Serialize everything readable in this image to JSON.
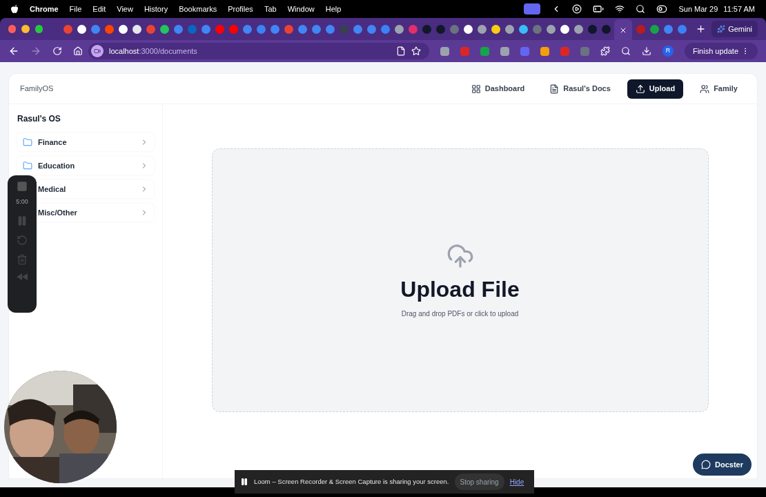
{
  "menubar": {
    "app": "Chrome",
    "menus": [
      "File",
      "Edit",
      "View",
      "History",
      "Bookmarks",
      "Profiles",
      "Tab",
      "Window",
      "Help"
    ],
    "date": "Sun Mar 29",
    "time": "11:57 AM"
  },
  "browser": {
    "url_host": "localhost",
    "url_path": ":3000/documents",
    "profile": "R",
    "update_button": "Finish update",
    "gemini": "Gemini"
  },
  "app": {
    "brand": "FamilyOS",
    "nav": [
      {
        "label": "Dashboard",
        "kind": "grid",
        "selected": false
      },
      {
        "label": "Rasul's Docs",
        "kind": "doc",
        "selected": false
      },
      {
        "label": "Upload",
        "kind": "upload",
        "selected": true
      },
      {
        "label": "Family",
        "kind": "people",
        "selected": false
      }
    ],
    "sidebar": {
      "title": "Rasul's OS",
      "folders": [
        {
          "label": "Finance",
          "icon": true
        },
        {
          "label": "Education",
          "icon": true
        },
        {
          "label": "Medical",
          "icon": false
        },
        {
          "label": "Misc/Other",
          "icon": false
        }
      ]
    },
    "upload": {
      "title": "Upload File",
      "subtitle": "Drag and drop PDFs or click to upload"
    },
    "chat_button": "Docster"
  },
  "recorder": {
    "timer": "5:00",
    "banner": "Loom – Screen Recorder & Screen Capture is sharing your screen.",
    "stop": "Stop sharing",
    "hide": "Hide"
  }
}
